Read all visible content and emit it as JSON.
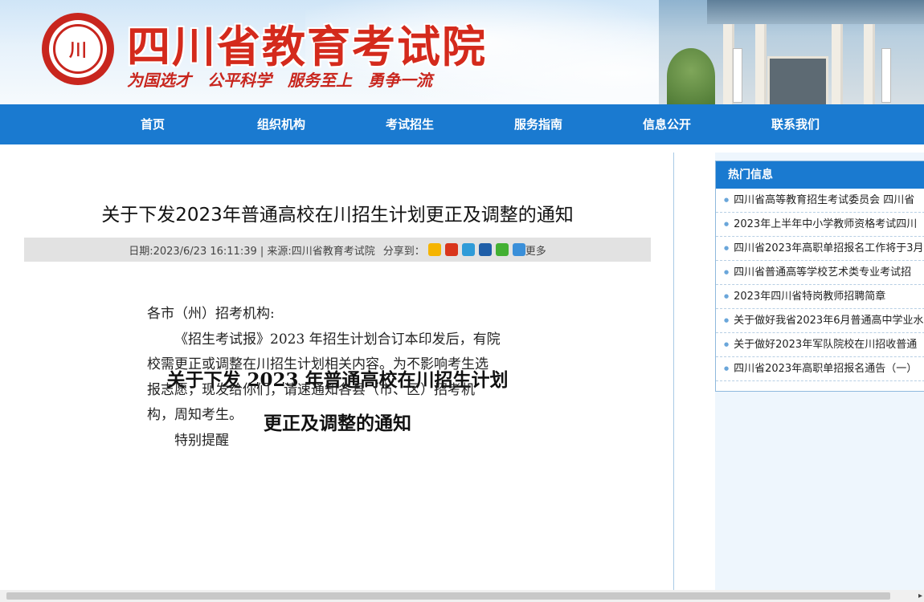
{
  "header": {
    "site_title": "四川省教育考试院",
    "slogans": [
      "为国选才",
      "公平科学",
      "服务至上",
      "勇争一流"
    ],
    "logo_icon": "emblem-icon"
  },
  "nav": {
    "items": [
      {
        "label": "首页"
      },
      {
        "label": "组织机构"
      },
      {
        "label": "考试招生"
      },
      {
        "label": "服务指南"
      },
      {
        "label": "信息公开"
      },
      {
        "label": "联系我们"
      }
    ]
  },
  "article": {
    "title": "关于下发2023年普通高校在川招生计划更正及调整的通知",
    "meta": "日期:2023/6/23 16:11:39 | 来源:四川省教育考试院",
    "share_label": "分享到：",
    "more_label": "更多",
    "share_icons": [
      {
        "name": "qzone-share-icon",
        "color": "#f5b400"
      },
      {
        "name": "weibo-share-icon",
        "color": "#d9361c"
      },
      {
        "name": "tencent-weibo-share-icon",
        "color": "#2f9bd8"
      },
      {
        "name": "renren-share-icon",
        "color": "#1f5ea8"
      },
      {
        "name": "wechat-share-icon",
        "color": "#43b033"
      },
      {
        "name": "more-share-icon",
        "color": "#3a8fd9"
      }
    ],
    "doc_heading_line1": "关于下发 2023 年普通高校在川招生计划",
    "doc_heading_line2": "更正及调整的通知",
    "salutation": "各市（州）招考机构:",
    "para_line1": "《招生考试报》2023 年招生计划合订本印发后，有院",
    "para_line2": "校需更正或调整在川招生计划相关内容。为不影响考生选",
    "para_line3": "报志愿，现发给你们，请速通知各县（市、区）招考机",
    "para_line4": "构，周知考生。",
    "partial_line": "特别提醒"
  },
  "sidebar": {
    "hot_title": "热门信息",
    "hot_items": [
      "四川省高等教育招生考试委员会 四川省",
      "2023年上半年中小学教师资格考试四川",
      "四川省2023年高职单招报名工作将于3月",
      "四川省普通高等学校艺术类专业考试招",
      "2023年四川省特岗教师招聘简章",
      "关于做好我省2023年6月普通高中学业水",
      "关于做好2023年军队院校在川招收普通",
      "四川省2023年高职单招报名通告（一）"
    ]
  },
  "colors": {
    "nav_bg": "#1a7ad0",
    "title_red": "#d42a1c",
    "meta_bg": "#e2e2e2"
  }
}
